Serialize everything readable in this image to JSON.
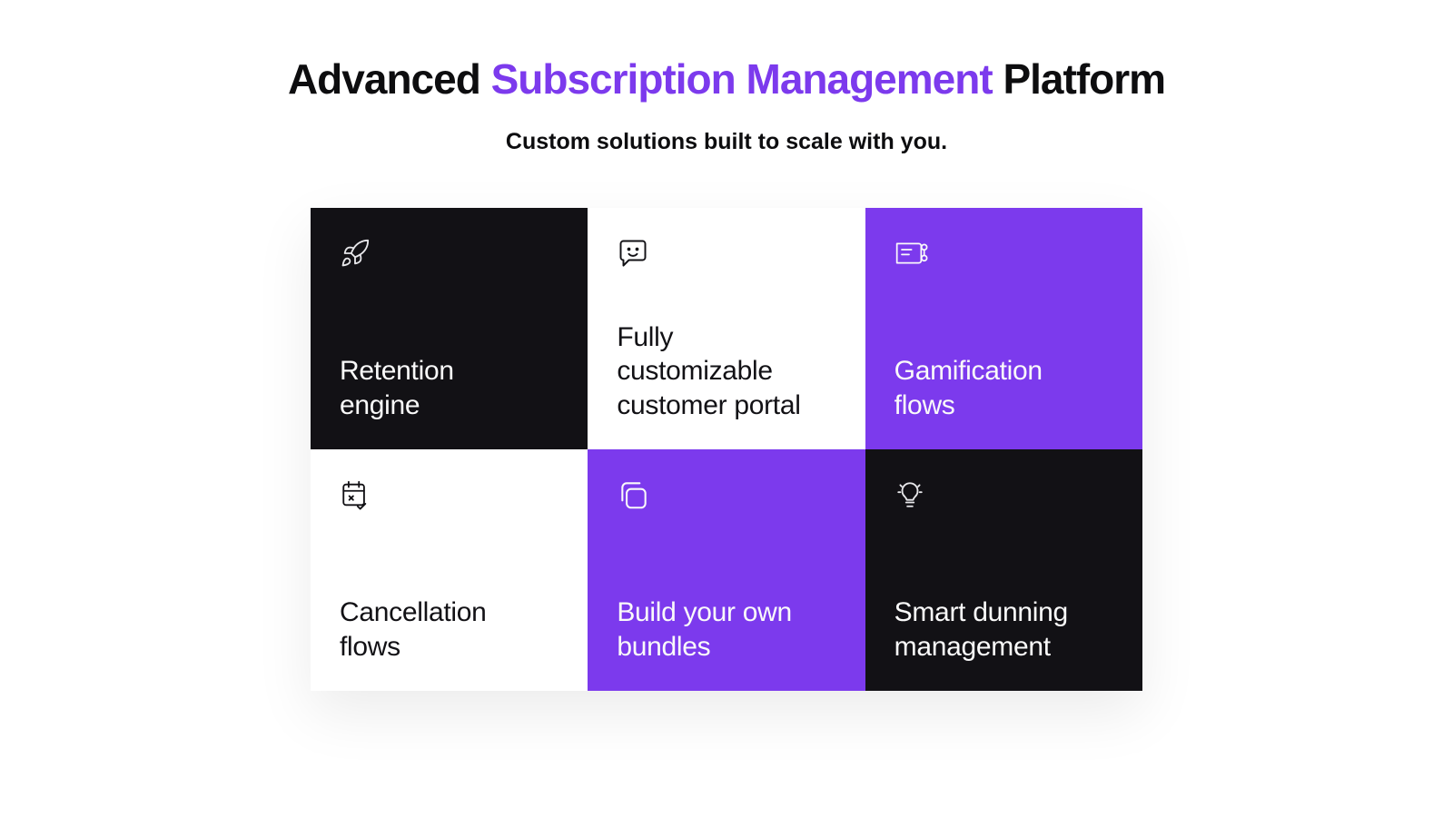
{
  "headline": {
    "pre": "Advanced ",
    "accent": "Subscription Management",
    "post": " Platform"
  },
  "subhead": "Custom solutions built to scale with you.",
  "cards": [
    {
      "title": "Retention\nengine"
    },
    {
      "title": "Fully customizable customer portal"
    },
    {
      "title": "Gamification flows"
    },
    {
      "title": "Cancellation flows"
    },
    {
      "title": "Build your own bundles"
    },
    {
      "title": "Smart dunning management"
    }
  ]
}
